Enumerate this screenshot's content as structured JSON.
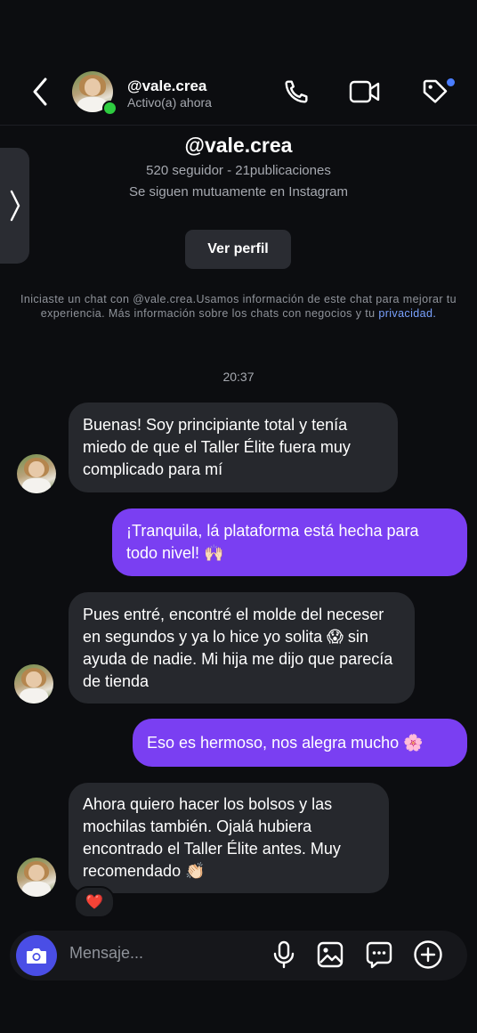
{
  "header": {
    "username": "@vale.crea",
    "status": "Activo(a) ahora",
    "icons": [
      "back-chevron-icon",
      "phone-icon",
      "video-camera-icon",
      "tag-icon"
    ]
  },
  "profile": {
    "name": "@vale.crea",
    "stats": "520 seguidor - 21publicaciones",
    "mutual": "Se siguen mutuamente en Instagram",
    "view_profile_label": "Ver perfil",
    "info_text": "Iniciaste un chat con @vale.crea.Usamos información de este chat para mejorar tu experiencia. Más información sobre los chats con negocios y tu",
    "info_link": "privacidad."
  },
  "chat": {
    "timestamp": "20:37",
    "messages": [
      {
        "from": "them",
        "text": "Buenas! Soy principiante total y tenía miedo de que el Taller Élite fuera muy complicado para mí"
      },
      {
        "from": "me",
        "text": "¡Tranquila, lá plataforma está hecha para todo nivel! 🙌🏻"
      },
      {
        "from": "them",
        "text": "Pues entré, encontré el molde del neceser en segundos y ya lo hice yo solita 😱 sin ayuda de nadie. Mi hija me dijo que parecía de tienda"
      },
      {
        "from": "me",
        "text": "Eso es hermoso, nos alegra mucho 🌸"
      },
      {
        "from": "them",
        "text": "Ahora quiero hacer los bolsos y las mochilas también. Ojalá hubiera encontrado el Taller Élite antes. Muy recomendado 👏🏻"
      }
    ],
    "reaction": "❤️"
  },
  "composer": {
    "placeholder": "Mensaje...",
    "icons": [
      "camera-icon",
      "microphone-icon",
      "image-icon",
      "sticker-icon",
      "plus-icon"
    ]
  },
  "colors": {
    "background": "#0c0d10",
    "incoming_bubble": "#26282d",
    "outgoing_bubble": "#7a3ff2",
    "camera_button": "#4a4ee6",
    "online": "#2ecc40"
  }
}
